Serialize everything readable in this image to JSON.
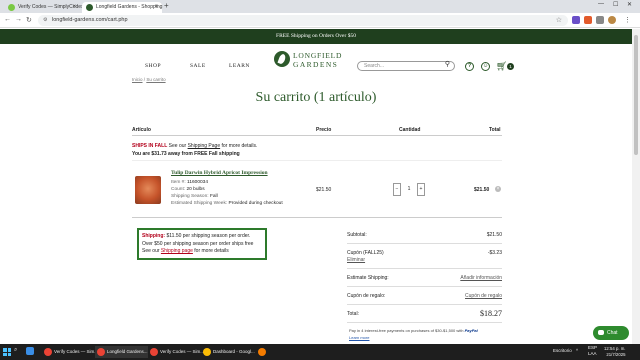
{
  "browser": {
    "tabs": [
      {
        "title": "Verify Codes — SimplyCodes",
        "active": false
      },
      {
        "title": "Longfield Gardens - Shopping",
        "active": true
      }
    ],
    "new_tab": "+",
    "url": "longfield-gardens.com/cart.php"
  },
  "site": {
    "promo": "FREE Shipping on Orders Over $50",
    "nav": {
      "shop": "SHOP",
      "sale": "SALE",
      "learn": "LEARN"
    },
    "logo": {
      "line1": "LONGFIELD",
      "line2": "GARDENS"
    },
    "search_placeholder": "Search...",
    "cart_count": "1",
    "breadcrumb": {
      "home": "Inicio",
      "sep": "/",
      "current": "Su carrito"
    },
    "title": "Su carrito (1 artículo)"
  },
  "cart": {
    "columns": {
      "item": "Artículo",
      "price": "Precio",
      "quantity": "Cantidad",
      "total": "Total"
    },
    "ships": {
      "label": "SHIPS IN FALL",
      "text1": "See our",
      "link": "Shipping Page",
      "text2": "for more details."
    },
    "away": "You are $31.73 away from FREE Fall shipping",
    "product": {
      "name": "Tulip Darwin Hybrid Apricot Impression",
      "item_label": "Item #:",
      "item_value": "11600034",
      "count_label": "Count:",
      "count_value": "20 bulbs",
      "season_label": "Shipping Season:",
      "season_value": "Fall",
      "week_label": "Estimated Shipping Week:",
      "week_value": "Provided during checkout",
      "price": "$21.50",
      "quantity": "1",
      "line_total": "$21.50",
      "qty_minus": "−",
      "qty_plus": "+",
      "remove": "×"
    },
    "shipping_box": {
      "label": "Shipping:",
      "line1": "$11.50  per shipping season per order.",
      "line2": "Over $50 per shipping season per order ships free",
      "line3a": "See our",
      "link": "Shipping page",
      "line3b": "for more details"
    }
  },
  "summary": {
    "subtotal_label": "Subtotal:",
    "subtotal_value": "$21.50",
    "coupon_label": "Cupón (FALL25)",
    "coupon_value": "-$3.23",
    "coupon_remove": "Eliminar",
    "est_label": "Estimate Shipping:",
    "est_link": "Añadir información",
    "gift_label": "Cupón de regalo:",
    "gift_link": "Cupón de regalo",
    "total_label": "Total:",
    "total_value": "$18.27",
    "paypal_text": "Pay in 4 interest-free payments on purchases of $30-$1,500 with",
    "paypal_brand": "PayPal",
    "learn_more": "Learn more"
  },
  "chat": {
    "label": "Chat"
  },
  "taskbar": {
    "search": "⌕",
    "items": [
      "Verify Codes — Sim...",
      "Longfield Gardens...",
      "Verify Codes — Sim...",
      "Dashboard - Googl..."
    ],
    "lang": "ESP",
    "lang2": "LAA",
    "weather": "Escritorio",
    "time": "12:54 p. m.",
    "date": "21/7/2025"
  },
  "colors": {
    "brand_green": "#2d5a2b",
    "promo_bg": "#1f3f1e",
    "alert_red": "#b3001b",
    "chat_green": "#2e8b2e"
  }
}
